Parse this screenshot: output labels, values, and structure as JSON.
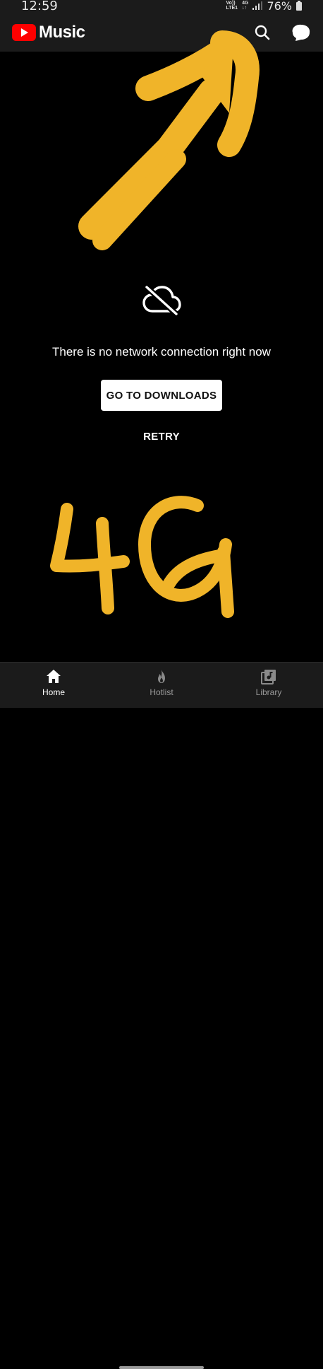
{
  "status_bar": {
    "time": "12:59",
    "volte_label": "Vo))",
    "lte_label": "LTE1",
    "network_type": "4G",
    "battery_percent": "76%"
  },
  "app_bar": {
    "logo_text": "Music",
    "brand_color": "#ff0000"
  },
  "offline": {
    "message": "There is no network connection right now",
    "downloads_label": "GO TO DOWNLOADS",
    "retry_label": "RETRY"
  },
  "annotations": {
    "handwritten_text": "4G",
    "color": "#f0b429"
  },
  "bottom_nav": {
    "items": [
      {
        "label": "Home",
        "icon": "home-icon",
        "active": true
      },
      {
        "label": "Hotlist",
        "icon": "flame-icon",
        "active": false
      },
      {
        "label": "Library",
        "icon": "library-music-icon",
        "active": false
      }
    ]
  }
}
